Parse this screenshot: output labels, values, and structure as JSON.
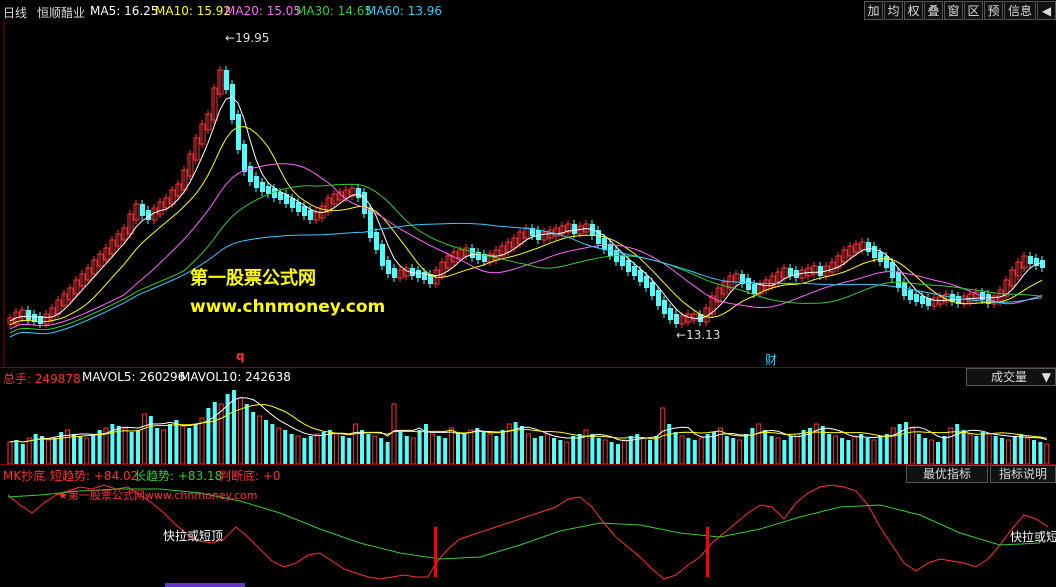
{
  "header": {
    "period": "日线",
    "stock_name": "恒顺醋业",
    "ma": [
      {
        "label": "MA5:",
        "value": "16.25",
        "color": "#ffffff"
      },
      {
        "label": "MA10:",
        "value": "15.92",
        "color": "#ffff00"
      },
      {
        "label": "MA20:",
        "value": "15.05",
        "color": "#ff66ff"
      },
      {
        "label": "MA30:",
        "value": "14.65",
        "color": "#33cc33"
      },
      {
        "label": "MA60:",
        "value": "13.96",
        "color": "#33ccff"
      }
    ],
    "toolbar": [
      "加",
      "均",
      "权",
      "叠",
      "窗",
      "区",
      "预",
      "信息"
    ]
  },
  "price_chart": {
    "high_label": "19.95",
    "low_label": "13.13",
    "marker_q": "q",
    "marker_cai": "财",
    "watermark_title": "第一股票公式网",
    "watermark_url": "www.chnmoney.com"
  },
  "volume": {
    "total_label": "总手:",
    "total_value": "249878",
    "mavol5_label": "MAVOL5:",
    "mavol5_value": "260296",
    "mavol10_label": "MAVOL10:",
    "mavol10_value": "242638",
    "selector_value": "成交量"
  },
  "indicator": {
    "name": "MK抄底",
    "short_label": "短趋势:",
    "short_value": "+84.02",
    "long_label": "长趋势:",
    "long_value": "+83.18",
    "judge_label": "判断底:",
    "judge_value": "+0",
    "best_button": "最优指标",
    "help_button": "指标说明",
    "watermark": "★第一股票公式网www.chnmoney.com",
    "annotation_1": "快拉或短顶",
    "annotation_2": "快拉或短顶"
  },
  "colors": {
    "up": "#ff3333",
    "down": "#54ffff",
    "ma5": "#ffffff",
    "ma10": "#ffff00",
    "ma20": "#ff66ff",
    "ma30": "#33cc33",
    "ma60": "#33ccff"
  }
}
